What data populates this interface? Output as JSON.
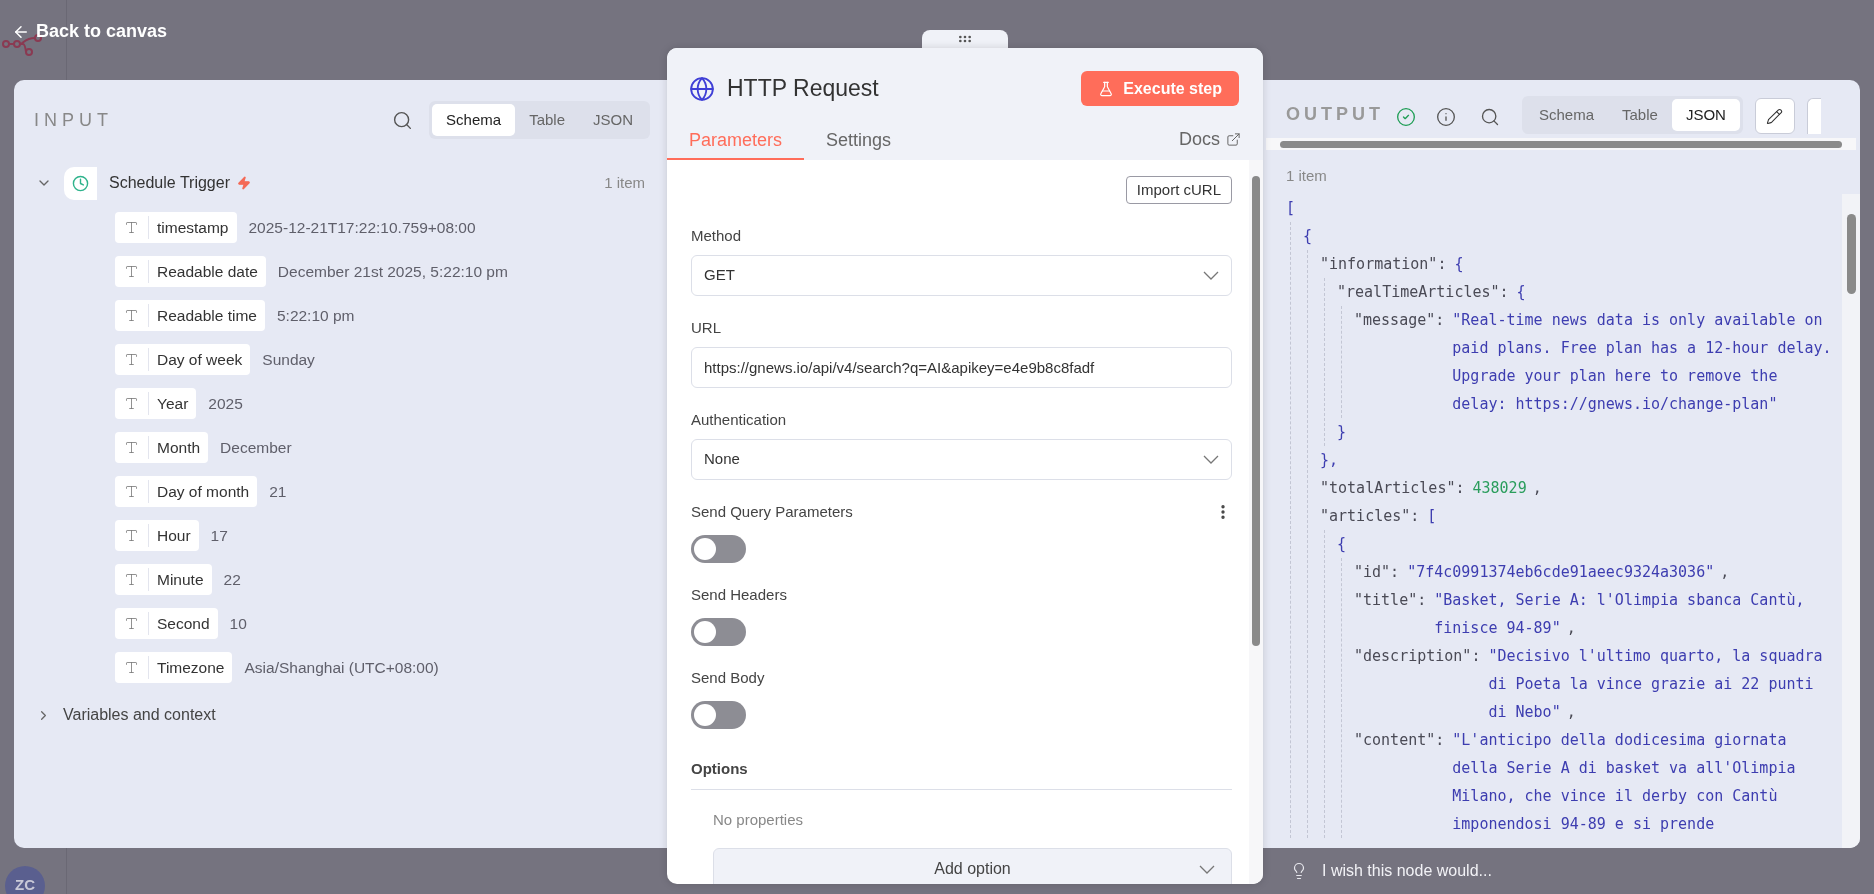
{
  "topbar": {
    "back_label": "Back to canvas"
  },
  "canvas": {
    "avatar_initials": "ZC"
  },
  "input": {
    "title": "INPUT",
    "view_tabs": [
      {
        "label": "Schema",
        "selected": true
      },
      {
        "label": "Table",
        "selected": false
      },
      {
        "label": "JSON",
        "selected": false
      }
    ],
    "node": {
      "name": "Schedule Trigger",
      "expanded": true,
      "count": "1 item",
      "fields": [
        {
          "name": "timestamp",
          "value": "2025-12-21T17:22:10.759+08:00"
        },
        {
          "name": "Readable date",
          "value": "December 21st 2025, 5:22:10 pm"
        },
        {
          "name": "Readable time",
          "value": "5:22:10 pm"
        },
        {
          "name": "Day of week",
          "value": "Sunday"
        },
        {
          "name": "Year",
          "value": "2025"
        },
        {
          "name": "Month",
          "value": "December"
        },
        {
          "name": "Day of month",
          "value": "21"
        },
        {
          "name": "Hour",
          "value": "17"
        },
        {
          "name": "Minute",
          "value": "22"
        },
        {
          "name": "Second",
          "value": "10"
        },
        {
          "name": "Timezone",
          "value": "Asia/Shanghai (UTC+08:00)"
        }
      ]
    },
    "extra_section": {
      "label": "Variables and context",
      "expanded": false
    }
  },
  "node_panel": {
    "title": "HTTP Request",
    "execute_label": "Execute step",
    "tabs": [
      {
        "label": "Parameters",
        "selected": true
      },
      {
        "label": "Settings",
        "selected": false
      }
    ],
    "docs_label": "Docs",
    "import_label": "Import cURL",
    "params": [
      {
        "kind": "select",
        "label": "Method",
        "value": "GET",
        "menu": false
      },
      {
        "kind": "text",
        "label": "URL",
        "value": "https://gnews.io/api/v4/search?q=AI&apikey=e4e9b8c8fadf",
        "menu": false
      },
      {
        "kind": "select",
        "label": "Authentication",
        "value": "None",
        "menu": false
      },
      {
        "kind": "toggle",
        "label": "Send Query Parameters",
        "on": false,
        "menu": true
      },
      {
        "kind": "toggle",
        "label": "Send Headers",
        "on": false,
        "menu": false
      },
      {
        "kind": "toggle",
        "label": "Send Body",
        "on": false,
        "menu": false
      }
    ],
    "options": {
      "title": "Options",
      "empty_text": "No properties",
      "add_label": "Add option"
    }
  },
  "output": {
    "title": "OUTPUT",
    "success": true,
    "view_tabs": [
      {
        "label": "Schema",
        "selected": false
      },
      {
        "label": "Table",
        "selected": false
      },
      {
        "label": "JSON",
        "selected": true
      }
    ],
    "count": "1 item",
    "json": {
      "kind": "block",
      "open": "[",
      "children": [
        {
          "kind": "block",
          "open": "{",
          "children": [
            {
              "kind": "block",
              "key": "\"information\":",
              "open": "{",
              "children": [
                {
                  "kind": "block",
                  "key": "\"realTimeArticles\":",
                  "open": "{",
                  "children": [
                    {
                      "kind": "string",
                      "key": "\"message\":",
                      "lines": [
                        "\"Real-time news data is only available on",
                        "paid plans. Free plan has a 12-hour delay.",
                        "Upgrade your plan here to remove the",
                        "delay: https://gnews.io/change-plan\""
                      ]
                    }
                  ],
                  "close": "}"
                }
              ],
              "close": "},"
            },
            {
              "kind": "number",
              "key": "\"totalArticles\":",
              "lines": [
                "438029"
              ],
              "suffix": ","
            },
            {
              "kind": "block",
              "key": "\"articles\":",
              "open": "[",
              "children": [
                {
                  "kind": "block",
                  "open": "{",
                  "children": [
                    {
                      "kind": "string",
                      "key": "\"id\":",
                      "lines": [
                        "\"7f4c0991374eb6cde91aeec9324a3036\""
                      ],
                      "suffix": ","
                    },
                    {
                      "kind": "string",
                      "key": "\"title\":",
                      "lines": [
                        "\"Basket, Serie A: l'Olimpia sbanca Cantù,",
                        "finisce 94-89\""
                      ],
                      "suffix": ","
                    },
                    {
                      "kind": "string",
                      "key": "\"description\":",
                      "lines": [
                        "\"Decisivo l'ultimo quarto, la squadra",
                        "di Poeta la vince grazie ai 22 punti",
                        "di Nebo\""
                      ],
                      "suffix": ","
                    },
                    {
                      "kind": "string",
                      "key": "\"content\":",
                      "lines": [
                        "\"L'anticipo della dodicesima giornata",
                        "della Serie A di basket va all'Olimpia",
                        "Milano, che vince il derby con Cantù",
                        "imponendosi 94-89 e si prende"
                      ]
                    }
                  ]
                }
              ]
            }
          ]
        }
      ]
    },
    "feedback_placeholder": "I wish this node would..."
  }
}
